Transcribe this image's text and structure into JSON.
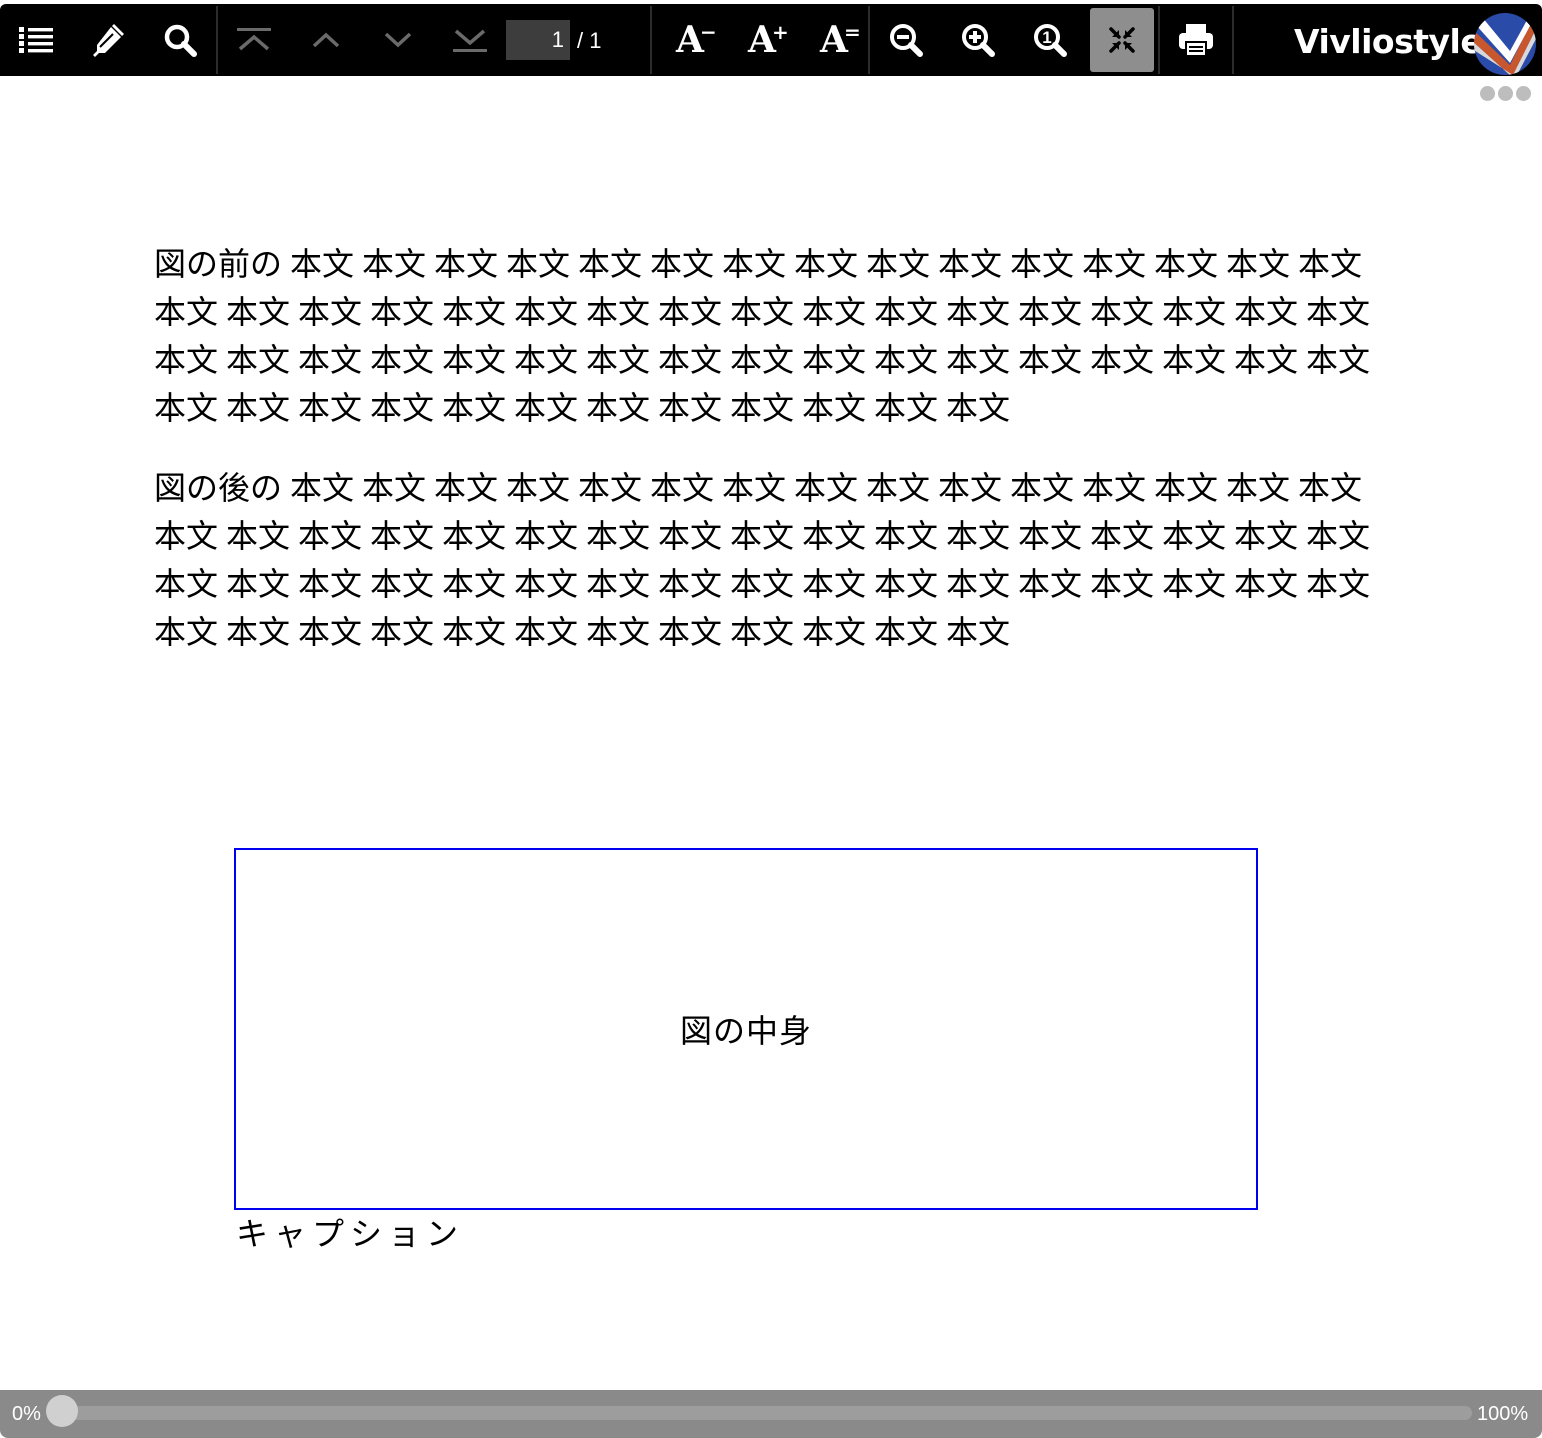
{
  "toolbar": {
    "buttons": [
      {
        "name": "toc-button",
        "icon": "list-icon"
      },
      {
        "name": "marker-button",
        "icon": "marker-icon"
      },
      {
        "name": "search-button",
        "icon": "search-icon"
      },
      {
        "name": "first-page-button",
        "icon": "first-page-icon"
      },
      {
        "name": "previous-page-button",
        "icon": "chevron-up-icon"
      },
      {
        "name": "next-page-button",
        "icon": "chevron-down-icon"
      },
      {
        "name": "last-page-button",
        "icon": "last-page-icon"
      },
      {
        "name": "font-size-decrease-button",
        "icon": "font-decrease-icon"
      },
      {
        "name": "font-size-increase-button",
        "icon": "font-increase-icon"
      },
      {
        "name": "font-size-reset-button",
        "icon": "font-reset-icon"
      },
      {
        "name": "zoom-out-button",
        "icon": "zoom-out-icon"
      },
      {
        "name": "zoom-in-button",
        "icon": "zoom-in-icon"
      },
      {
        "name": "zoom-actual-button",
        "icon": "zoom-actual-icon"
      },
      {
        "name": "fit-to-screen-button",
        "icon": "fit-screen-icon",
        "active": true
      },
      {
        "name": "print-button",
        "icon": "print-icon"
      }
    ],
    "page_number": "1",
    "page_total": "/ 1",
    "font_decrease_label": "A",
    "font_increase_label": "A",
    "font_reset_label": "A",
    "font_decrease_sup": "−",
    "font_increase_sup": "+",
    "font_reset_sup": "=",
    "zoom_actual_label": "1",
    "brand": "Vivliostyle",
    "logo_icon": "vivliostyle-logo-icon",
    "more_menu_icon": "more-dots-icon"
  },
  "document": {
    "paragraph_before": {
      "lines": [
        "図の前の 本文 本文 本文 本文 本文 本文 本文 本文 本文 本文 本文 本文 本文 本文 本文",
        "本文 本文 本文 本文 本文 本文 本文 本文 本文 本文 本文 本文 本文 本文 本文 本文 本文",
        "本文 本文 本文 本文 本文 本文 本文 本文 本文 本文 本文 本文 本文 本文 本文 本文 本文",
        "本文 本文 本文 本文 本文 本文 本文 本文 本文 本文 本文 本文"
      ]
    },
    "paragraph_after": {
      "lines": [
        "図の後の 本文 本文 本文 本文 本文 本文 本文 本文 本文 本文 本文 本文 本文 本文 本文",
        "本文 本文 本文 本文 本文 本文 本文 本文 本文 本文 本文 本文 本文 本文 本文 本文 本文",
        "本文 本文 本文 本文 本文 本文 本文 本文 本文 本文 本文 本文 本文 本文 本文 本文 本文",
        "本文 本文 本文 本文 本文 本文 本文 本文 本文 本文 本文 本文"
      ]
    },
    "figure_content": "図の中身",
    "figure_border_color": "#0000ee",
    "caption": "キャプション"
  },
  "progress": {
    "start_label": "0%",
    "end_label": "100%",
    "value_percent": 0
  },
  "colors": {
    "toolbar_bg": "#000000",
    "active_button_bg": "#8e8e8e",
    "progress_bg": "#8a8a8a",
    "logo_blue": "#2b4ba8",
    "logo_orange": "#c9572d"
  }
}
